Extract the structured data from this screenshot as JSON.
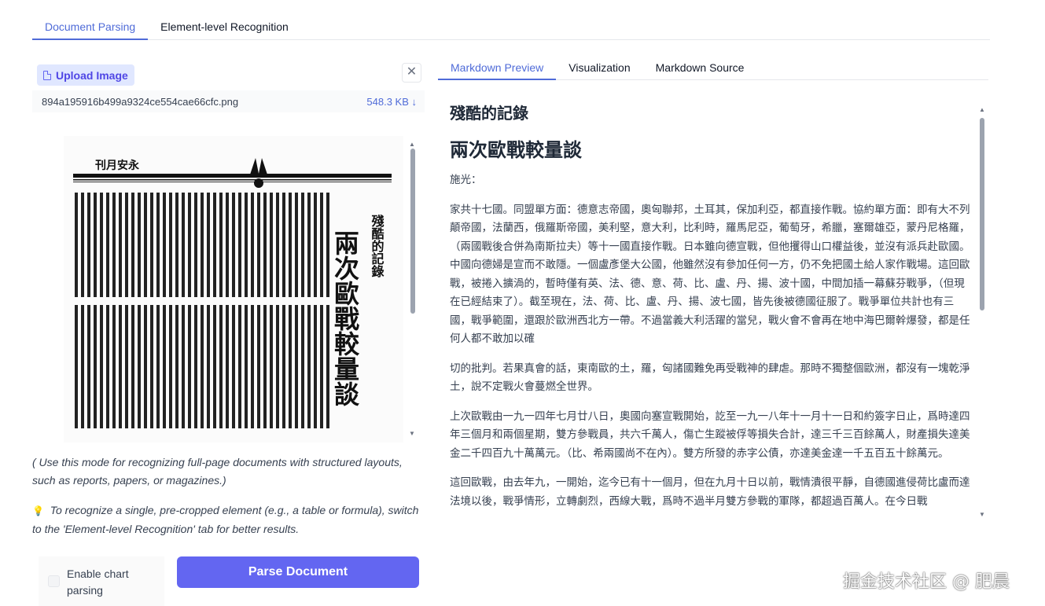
{
  "top_tabs": [
    {
      "label": "Document Parsing",
      "active": true
    },
    {
      "label": "Element-level Recognition",
      "active": false
    }
  ],
  "upload": {
    "button_label": "Upload Image",
    "close_symbol": "✕",
    "file_name": "894a195916b499a9324ce554cae66cfc.png",
    "file_size": "548.3 KB ↓"
  },
  "preview": {
    "publication": "刊月安永",
    "title_small": "殘酷的記錄",
    "title_large": "兩次歐戰較量談"
  },
  "hints": {
    "mode_note": "( Use this mode for recognizing full-page documents with structured layouts, such as reports, papers, or magazines.)",
    "tip_icon": "💡",
    "tip_text": "To recognize a single, pre-cropped element (e.g., a table or formula), switch to the 'Element-level Recognition' tab for better results."
  },
  "chart_parsing_label": "Enable chart parsing",
  "parse_button": "Parse Document",
  "right_tabs": [
    {
      "label": "Markdown Preview",
      "active": true
    },
    {
      "label": "Visualization",
      "active": false
    },
    {
      "label": "Markdown Source",
      "active": false
    }
  ],
  "markdown": {
    "heading_small": "殘酷的記錄",
    "heading_large": "兩次歐戰較量談",
    "author": "施光：",
    "paragraphs": [
      "家共十七國。同盟單方面：德意志帝國，奧匈聯邦，土耳其，保加利亞，都直接作戰。協約單方面：即有大不列顛帝國，法蘭西，俄羅斯帝國，美利堅，意大利，比利時，羅馬尼亞，葡萄牙，希臘，塞爾雄亞，蒙丹尼格羅，（兩國戰後合併為南斯拉夫）等十一國直接作戰。日本雖向德宣戰，但他攫得山口權益後，並沒有派兵赴歐國。中國向德婦是宣而不敢隱。一個盧彥堡大公國，他雖然沒有參加任何一方，仍不免把國土給人家作戰場。這回歐戰，被捲入擴渦的，暫時僅有英、法、德、意、荷、比、盧、丹、揚、波十國，中間加插一幕蘇芬戰爭，（但現在已經結束了）。截至現在，法、荷、比、盧、丹、揚、波七國，皆先後被德國征服了。戰爭單位共計也有三國，戰爭範圍，還跟於歐洲西北方一帶。不過當義大利活躍的當兒，戰火會不會再在地中海巴爾幹爆發，都是任何人都不敢加以確",
      "切的批判。若果真會的話，東南歐的土，羅，匈諸國難免再受戰神的肆虐。那時不獨整個歐洲，都沒有一塊乾淨土，說不定戰火會蔓燃全世界。",
      "上次歐戰由一九一四年七月廿八日，奧國向塞宣戰開始，訖至一九一八年十一月十一日和約簽字日止，爲時達四年三個月和兩個星期，雙方參戰員，共六千萬人，傷亡生蹤被俘等損失合計，達三千三百餘萬人，財產損失達美金二千四百九十萬萬元。（比、希兩國尚不在內）。雙方所發的赤字公債，亦達美金達一千五百五十餘萬元。",
      "這回歐戰，由去年九，一開始，迄今已有十一個月，但在九月十日以前，戰情潰很平靜，自德國進侵荷比盧而達法境以後，戰爭情形，立轉劇烈，西線大戰，爲時不過半月雙方參戰的軍隊，都超過百萬人。在今日戰"
    ]
  },
  "watermark": "掘金技术社区 @ 肥晨"
}
